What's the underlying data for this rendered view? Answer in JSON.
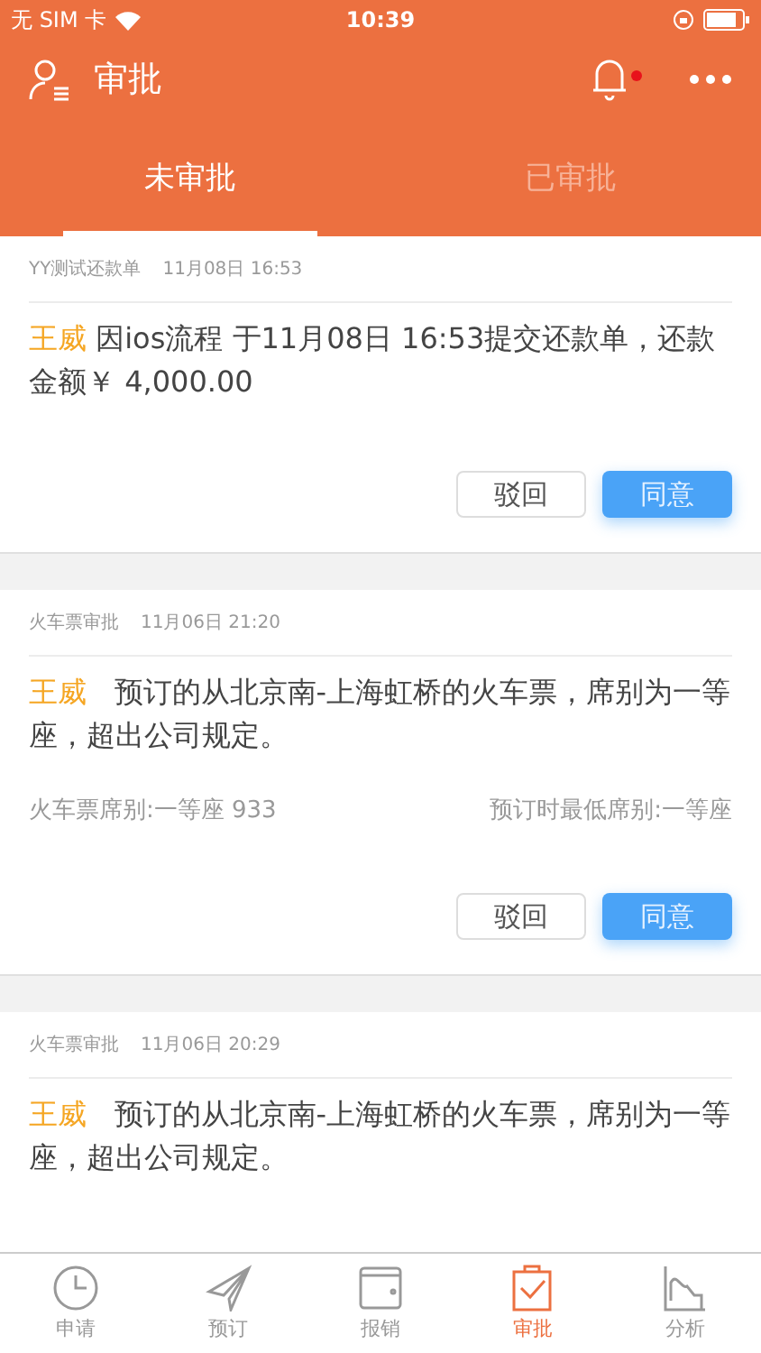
{
  "status_bar": {
    "carrier": "无 SIM 卡",
    "time": "10:39"
  },
  "header": {
    "title": "审批"
  },
  "tabs": [
    {
      "label": "未审批",
      "selected": true
    },
    {
      "label": "已审批",
      "selected": false
    }
  ],
  "approvals": [
    {
      "type": "YY测试还款单",
      "time": "11月08日 16:53",
      "applicant": "王威",
      "message": "因ios流程 于11月08日 16:53提交还款单，还款金额￥ 4,000.00",
      "buttons": [
        {
          "label": "驳回",
          "kind": "reject"
        },
        {
          "label": "同意",
          "kind": "approve"
        }
      ]
    },
    {
      "type": "火车票审批",
      "time": "11月06日 21:20",
      "applicant": "王威",
      "message": "  预订的从北京南-上海虹桥的火车票，席别为一等座，超出公司规定。",
      "details": {
        "left": "火车票席别:一等座 933",
        "right": "预订时最低席别:一等座"
      },
      "buttons": [
        {
          "label": "驳回",
          "kind": "reject"
        },
        {
          "label": "同意",
          "kind": "approve"
        }
      ]
    },
    {
      "type": "火车票审批",
      "time": "11月06日 20:29",
      "applicant": "王威",
      "message": "  预订的从北京南-上海虹桥的火车票，席别为一等座，超出公司规定。"
    }
  ],
  "tab_bar": [
    {
      "label": "申请",
      "kind": "clock",
      "selected": false
    },
    {
      "label": "预订",
      "kind": "plane",
      "selected": false
    },
    {
      "label": "报销",
      "kind": "wallet",
      "selected": false
    },
    {
      "label": "审批",
      "kind": "clipboard",
      "selected": true
    },
    {
      "label": "分析",
      "kind": "chart",
      "selected": false
    }
  ]
}
